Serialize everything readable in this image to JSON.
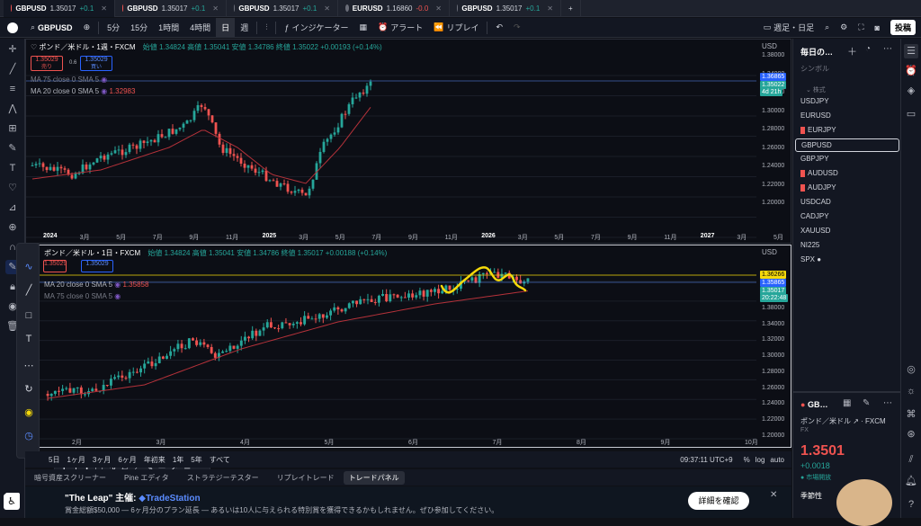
{
  "tabs": [
    {
      "sym": "GBPUSD",
      "price": "1.35017",
      "chg": "+0.1",
      "dir": "up",
      "icon": "red"
    },
    {
      "sym": "GBPUSD",
      "price": "1.35017",
      "chg": "+0.1",
      "dir": "up",
      "icon": "red"
    },
    {
      "sym": "GBPUSD",
      "price": "1.35017",
      "chg": "+0.1",
      "dir": "up",
      "icon": "gray"
    },
    {
      "sym": "EURUSD",
      "price": "1.16860",
      "chg": "-0.0",
      "dir": "dn",
      "icon": "gray"
    },
    {
      "sym": "GBPUSD",
      "price": "1.35017",
      "chg": "+0.1",
      "dir": "up",
      "icon": "gray"
    }
  ],
  "toolbar": {
    "symbol": "GBPUSD",
    "intervals": [
      "5分",
      "15分",
      "1時間",
      "4時間",
      "日",
      "週"
    ],
    "selected_interval": "日",
    "indicators": "インジケーター",
    "alert": "アラート",
    "replay": "リプレイ",
    "layout": "週足・日足",
    "publish": "投稿"
  },
  "top_pane": {
    "title": "ポンド／米ドル・1週・FXCM",
    "ohlc": "始値 1.34824  高値 1.35041  安値 1.34786  終値 1.35022  +0.00193 (+0.14%)",
    "sell_price": "1.35029",
    "sell_label": "売り",
    "spread": "0.6",
    "buy_price": "1.35029",
    "buy_label": "買い",
    "ma1": "MA 75 close 0 SMA 5",
    "ma2": "MA 20 close 0 SMA 5",
    "ma2_val": "1.32983",
    "currency": "USD",
    "y_ticks": [
      "1.38000",
      "1.34000",
      "1.32000",
      "1.30000",
      "1.28000",
      "1.26000",
      "1.24000",
      "1.22000",
      "1.20000"
    ],
    "price_labels": [
      "1.36865",
      "1.35022",
      "4d 21h"
    ],
    "x_ticks": [
      "2024",
      "3月",
      "5月",
      "7月",
      "9月",
      "11月",
      "2025",
      "3月",
      "5月",
      "7月",
      "9月",
      "11月",
      "2026",
      "3月",
      "5月",
      "7月",
      "9月",
      "11月",
      "2027",
      "3月",
      "5月"
    ]
  },
  "bottom_pane": {
    "title": "ポンド／米ドル・1日・FXCM",
    "ohlc": "始値 1.34824  高値 1.35041  安値 1.34786  終値 1.35017  +0.00188 (+0.14%)",
    "sell_price": "1.35029",
    "buy_price": "1.35029",
    "ma1": "MA 20 close 0 SMA 5",
    "ma1_val": "1.35858",
    "ma2": "MA 75 close 0 SMA 5",
    "currency": "USD",
    "y_ticks": [
      "1.38000",
      "1.34000",
      "1.32000",
      "1.30000",
      "1.28000",
      "1.26000",
      "1.24000",
      "1.22000",
      "1.20000"
    ],
    "price_labels": [
      "1.36266",
      "1.35865",
      "1.35017",
      "20:22:48"
    ],
    "x_ticks": [
      "2月",
      "3月",
      "4月",
      "5月",
      "6月",
      "7月",
      "8月",
      "9月",
      "10月"
    ]
  },
  "range_bar": {
    "items": [
      "5日",
      "1ヶ月",
      "3ヶ月",
      "6ヶ月",
      "年初来",
      "1年",
      "5年",
      "すべて"
    ],
    "clock": "09:37:11 UTC+9"
  },
  "bottom_tabs": [
    "暗号資産スクリーナー",
    "Pine エディタ",
    "ストラテジーテスター",
    "リプレイトレード",
    "トレードパネル"
  ],
  "ad": {
    "title": "\"The Leap\" 主催:",
    "brand": "TradeStation",
    "body": "賞金総額$50,000 — 6ヶ月分のプラン延長 — あるいは10人に与えられる特別賞を獲得できるかもしれません。ぜひ参加してください。",
    "cta": "詳細を確認"
  },
  "watchlist": {
    "title": "毎日の…",
    "col": "シンボル",
    "section": "株式",
    "items": [
      {
        "s": "USDJPY",
        "flag": false
      },
      {
        "s": "EURUSD",
        "flag": false
      },
      {
        "s": "EURJPY",
        "flag": true
      },
      {
        "s": "GBPUSD",
        "flag": false
      },
      {
        "s": "GBPJPY",
        "flag": false
      },
      {
        "s": "AUDUSD",
        "flag": true
      },
      {
        "s": "AUDJPY",
        "flag": true
      },
      {
        "s": "USDCAD",
        "flag": false
      },
      {
        "s": "CADJPY",
        "flag": false
      },
      {
        "s": "XAUUSD",
        "flag": false
      },
      {
        "s": "NI225",
        "flag": false
      },
      {
        "s": "SPX",
        "flag": false
      }
    ],
    "detail_sym": "GB…",
    "detail_name": "ポンド／米ドル",
    "detail_src": "FXCM",
    "detail_type": "FX",
    "detail_price": "1.3501",
    "detail_chg": "+0.0018",
    "detail_status": "市場開放",
    "season": "季節性"
  },
  "colors": {
    "up": "#26a69a",
    "down": "#ef5350",
    "ma": "#b5323a",
    "highlight": "#f5d90a"
  }
}
